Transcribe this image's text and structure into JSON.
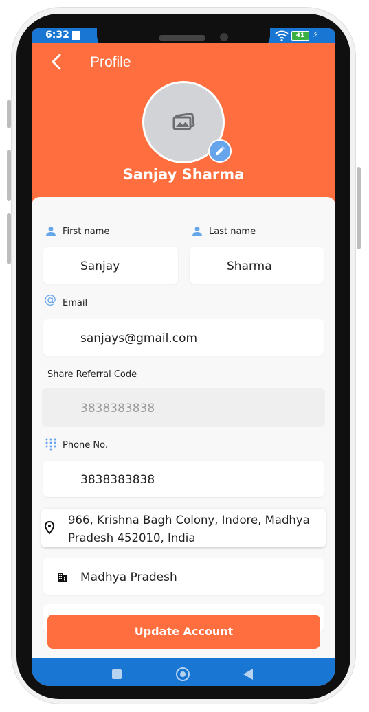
{
  "status_bar": {
    "time": "6:32",
    "battery": "41"
  },
  "header": {
    "back_icon": "chevron-left-icon",
    "title": "Profile"
  },
  "profile": {
    "name": "Sanjay Sharma",
    "avatar_icon": "image-placeholder-icon",
    "edit_icon": "pencil-icon"
  },
  "form": {
    "first_name": {
      "label": "First name",
      "value": "Sanjay"
    },
    "last_name": {
      "label": "Last name",
      "value": "Sharma"
    },
    "email": {
      "label": "Email",
      "value": "sanjays@gmail.com"
    },
    "referral": {
      "label": "Share Referral Code",
      "value": "3838383838"
    },
    "phone": {
      "label": "Phone No.",
      "value": "3838383838"
    },
    "address": {
      "line1": "966, Krishna Bagh Colony, Indore, Madhya",
      "line2": "Pradesh 452010, India"
    },
    "state": {
      "value": "Madhya Pradesh"
    }
  },
  "update_button": {
    "label": "Update Account"
  },
  "colors": {
    "accent": "#ff6e3e",
    "status_blue": "#1976d2",
    "icon_blue": "#66a5ec"
  }
}
